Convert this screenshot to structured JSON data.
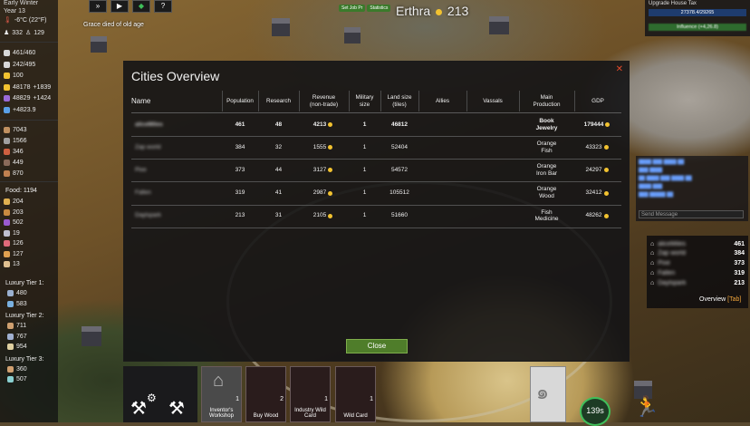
{
  "top_left": {
    "season": "Early Winter",
    "year": "Year 13",
    "temperature": "-6°C (22°F)",
    "pop_a": "332",
    "pop_b": "129"
  },
  "resources_top": [
    {
      "icon": "house-icon",
      "value": "461/460",
      "color": "#d8d8d8"
    },
    {
      "icon": "worker-icon",
      "value": "242/495",
      "color": "#d8d8d8"
    },
    {
      "icon": "happiness-icon",
      "value": "100",
      "color": "#f2c230"
    },
    {
      "icon": "gold-coin-icon",
      "value": "48178",
      "delta": "+1839",
      "color": "#f2c230"
    },
    {
      "icon": "influence-icon",
      "value": "48829",
      "delta": "+1424",
      "color": "#9a6ad8"
    },
    {
      "icon": "science-icon",
      "value": "+4823.9",
      "color": "#5aa0e8"
    }
  ],
  "materials": [
    {
      "icon": "wood-icon",
      "value": "7043",
      "color": "#c09060"
    },
    {
      "icon": "stone-icon",
      "value": "1566",
      "color": "#a0a0a0"
    },
    {
      "icon": "brick-icon",
      "value": "346",
      "color": "#d06040"
    },
    {
      "icon": "iron-icon",
      "value": "449",
      "color": "#8a6a5a"
    },
    {
      "icon": "tools-icon",
      "value": "870",
      "color": "#c08050"
    }
  ],
  "food": {
    "label": "Food: 1194",
    "items": [
      {
        "icon": "wheat-icon",
        "value": "204",
        "color": "#e0b050"
      },
      {
        "icon": "bread-icon",
        "value": "203",
        "color": "#c88a40"
      },
      {
        "icon": "grape-icon",
        "value": "502",
        "color": "#9a5ad0"
      },
      {
        "icon": "fish-icon",
        "value": "19",
        "color": "#c0c0d0"
      },
      {
        "icon": "meat-icon",
        "value": "126",
        "color": "#e06a7a"
      },
      {
        "icon": "cheese-icon",
        "value": "127",
        "color": "#e0a050"
      },
      {
        "icon": "egg-icon",
        "value": "13",
        "color": "#e0c090"
      }
    ]
  },
  "luxury": [
    {
      "label": "Luxury Tier 1:",
      "items": [
        {
          "icon": "clothes-icon",
          "value": "480",
          "color": "#9ab0d0"
        },
        {
          "icon": "pottery-icon",
          "value": "583",
          "color": "#7ab0e0"
        }
      ]
    },
    {
      "label": "Luxury Tier 2:",
      "items": [
        {
          "icon": "furniture-icon",
          "value": "711",
          "color": "#d0a070"
        },
        {
          "icon": "beer-icon",
          "value": "767",
          "color": "#a0b0d0"
        },
        {
          "icon": "candle-icon",
          "value": "954",
          "color": "#e0d0a0"
        }
      ]
    },
    {
      "label": "Luxury Tier 3:",
      "items": [
        {
          "icon": "wine-icon",
          "value": "360",
          "color": "#d0a070"
        },
        {
          "icon": "jewelry-icon",
          "value": "507",
          "color": "#8ad0d0"
        }
      ]
    }
  ],
  "notification": "Grace died of old age",
  "top_buttons": {
    "set_job": "Set Job Pr",
    "statistics": "Statistics"
  },
  "city": {
    "name": "Erthra",
    "coins": "213"
  },
  "upgrade": {
    "title": "Upgrade House Tax",
    "progress_text": "27378.4/29265",
    "progress_fraction": 0.935,
    "sub": "Influence (+4,26.8)"
  },
  "chat": {
    "input_placeholder": "Send Message"
  },
  "modal": {
    "title": "Cities Overview",
    "columns": [
      "Name",
      "Population",
      "Research",
      "Revenue\n(non-trade)",
      "Military\nsize",
      "Land size\n(tiles)",
      "Allies",
      "Vassals",
      "Main\nProduction",
      "GDP"
    ],
    "rows": [
      {
        "name": "aliceMiles",
        "population": "461",
        "research": "48",
        "revenue": "4213",
        "military": "1",
        "land": "46812",
        "allies": "",
        "vassals": "",
        "production": "Book\nJewelry",
        "gdp": "179444"
      },
      {
        "name": "Zap world",
        "population": "384",
        "research": "32",
        "revenue": "1555",
        "military": "1",
        "land": "52404",
        "allies": "",
        "vassals": "",
        "production": "Orange\nFish",
        "gdp": "43323"
      },
      {
        "name": "Pixe",
        "population": "373",
        "research": "44",
        "revenue": "3127",
        "military": "1",
        "land": "54572",
        "allies": "",
        "vassals": "",
        "production": "Orange\nIron Bar",
        "gdp": "24297"
      },
      {
        "name": "Fallen",
        "population": "319",
        "research": "41",
        "revenue": "2987",
        "military": "1",
        "land": "105512",
        "allies": "",
        "vassals": "",
        "production": "Orange\nWood",
        "gdp": "32412"
      },
      {
        "name": "Daylspark",
        "population": "213",
        "research": "31",
        "revenue": "2105",
        "military": "1",
        "land": "51660",
        "allies": "",
        "vassals": "",
        "production": "Fish\nMedicine",
        "gdp": "48262"
      }
    ],
    "close_label": "Close"
  },
  "mini_overview": {
    "rows": [
      {
        "name": "aliceMiles",
        "value": "461"
      },
      {
        "name": "Zap world",
        "value": "384"
      },
      {
        "name": "Pixe",
        "value": "373"
      },
      {
        "name": "Fallen",
        "value": "319"
      },
      {
        "name": "Daylspark",
        "value": "213"
      }
    ],
    "label": "Overview",
    "tab": "[Tab]"
  },
  "cards": [
    {
      "label": "Inventor's Workshop",
      "count": "1"
    },
    {
      "label": "Buy Wood",
      "count": "2"
    },
    {
      "label": "Industry Wild Card",
      "count": "1"
    },
    {
      "label": "Wild Card",
      "count": "1"
    }
  ],
  "timer": "139s"
}
